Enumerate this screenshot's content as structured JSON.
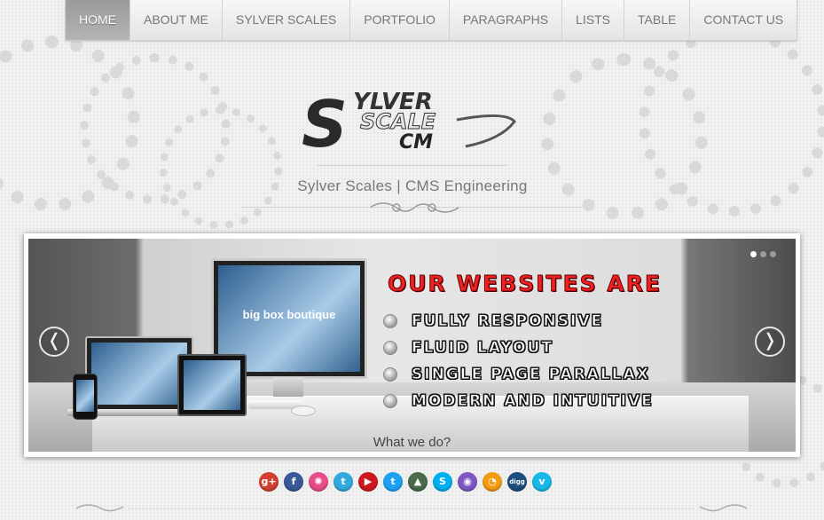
{
  "nav": {
    "items": [
      {
        "label": "HOME",
        "active": true
      },
      {
        "label": "ABOUT ME",
        "active": false
      },
      {
        "label": "SYLVER SCALES",
        "active": false
      },
      {
        "label": "PORTFOLIO",
        "active": false
      },
      {
        "label": "PARAGRAPHS",
        "active": false
      },
      {
        "label": "LISTS",
        "active": false
      },
      {
        "label": "TABLE",
        "active": false
      },
      {
        "label": "CONTACT US",
        "active": false
      }
    ]
  },
  "logo": {
    "line1": "YLVER",
    "line2": "SCALE",
    "line3": "CM",
    "initial": "S"
  },
  "tagline": "Sylver Scales | CMS Engineering",
  "slider": {
    "headline": "OUR WEBSITES ARE",
    "bullets": [
      "FULLY RESPONSIVE",
      "FLUID LAYOUT",
      "SINGLE PAGE PARALLAX",
      "MODERN AND INTUITIVE"
    ],
    "caption": "What we do?",
    "prev_glyph": "❬",
    "next_glyph": "❭",
    "device_screen_text": "big box boutique",
    "pager_count": 3,
    "pager_active": 0
  },
  "social": [
    {
      "name": "google-plus-icon",
      "glyph": "g+",
      "color": "#d23f31"
    },
    {
      "name": "facebook-icon",
      "glyph": "f",
      "color": "#3b5998"
    },
    {
      "name": "dribbble-icon",
      "glyph": "✺",
      "color": "#ea4c89"
    },
    {
      "name": "twitter-bird-icon",
      "glyph": "t",
      "color": "#33aadd"
    },
    {
      "name": "youtube-icon",
      "glyph": "▶",
      "color": "#cc181e"
    },
    {
      "name": "twitter-icon",
      "glyph": "t",
      "color": "#1da1f2"
    },
    {
      "name": "forrst-icon",
      "glyph": "▲",
      "color": "#4b6b4b"
    },
    {
      "name": "skype-icon",
      "glyph": "S",
      "color": "#00aff0"
    },
    {
      "name": "picasa-icon",
      "glyph": "◉",
      "color": "#7e57c2"
    },
    {
      "name": "rss-icon",
      "glyph": "◔",
      "color": "#f39c12"
    },
    {
      "name": "digg-icon",
      "glyph": "digg",
      "color": "#1d4d7d"
    },
    {
      "name": "vimeo-icon",
      "glyph": "v",
      "color": "#1ab7ea"
    }
  ]
}
